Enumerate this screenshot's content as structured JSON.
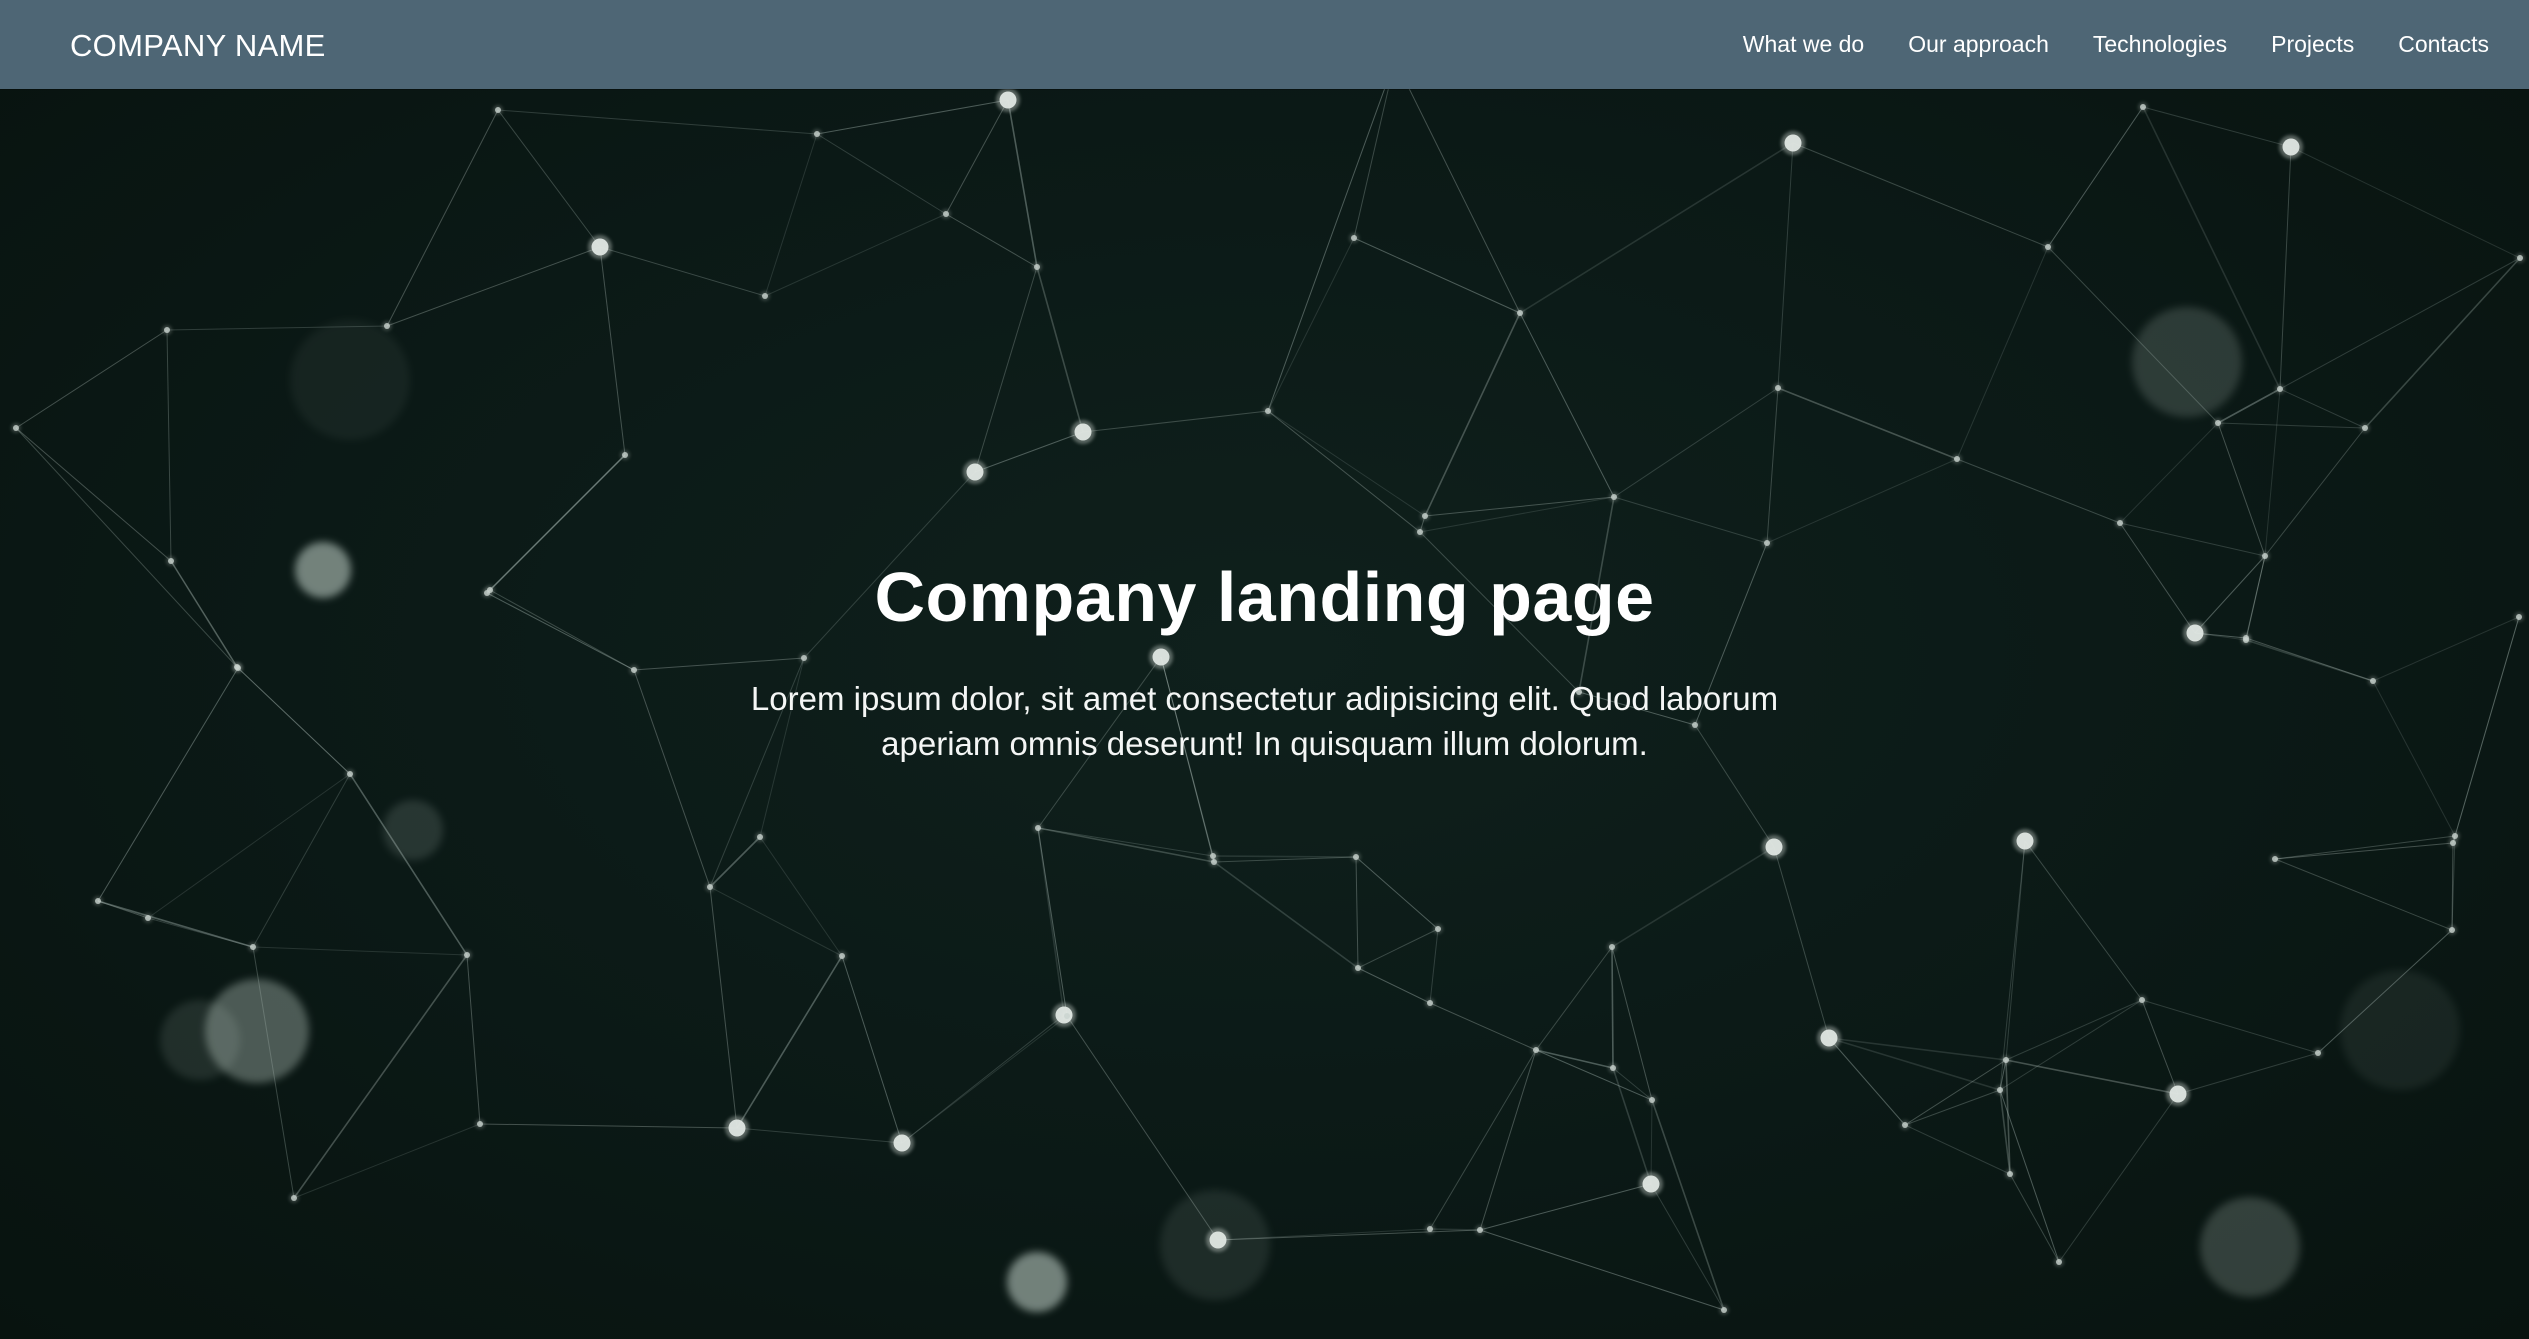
{
  "navbar": {
    "brand": "COMPANY NAME",
    "links": [
      {
        "label": "What we do"
      },
      {
        "label": "Our approach"
      },
      {
        "label": "Technologies"
      },
      {
        "label": "Projects"
      },
      {
        "label": "Contacts"
      }
    ]
  },
  "hero": {
    "title": "Company landing page",
    "text": "Lorem ipsum dolor, sit amet consectetur adipisicing elit. Quod laborum aperiam omnis deserunt! In quisquam illum dolorum.",
    "background": "network-particles-image"
  },
  "colors": {
    "navbar": "#4e6675",
    "hero_bg": "#0b1916",
    "text": "#ffffff"
  }
}
